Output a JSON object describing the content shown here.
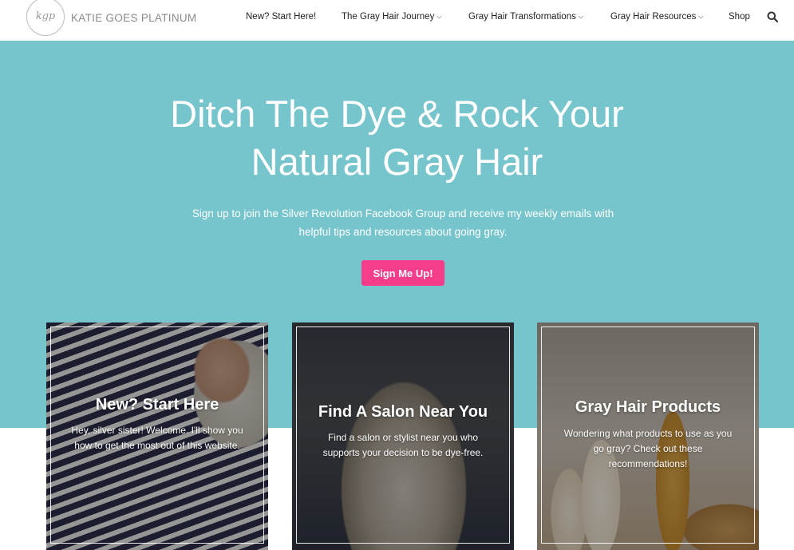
{
  "site": {
    "logo_mark": "kgp",
    "logo_text": "KATIE GOES PLATINUM"
  },
  "nav": {
    "items": [
      {
        "label": "New? Start Here!",
        "has_dropdown": false
      },
      {
        "label": "The Gray Hair Journey",
        "has_dropdown": true
      },
      {
        "label": "Gray Hair Transformations",
        "has_dropdown": true
      },
      {
        "label": "Gray Hair Resources",
        "has_dropdown": true
      },
      {
        "label": "Shop",
        "has_dropdown": false
      }
    ],
    "dropdown_glyph": "⌵",
    "search_icon": "search-icon"
  },
  "hero": {
    "title_line1": "Ditch The Dye & Rock Your",
    "title_line2": "Natural Gray Hair",
    "subtitle": "Sign up to join the Silver Revolution Facebook Group and receive my weekly emails with helpful tips and resources about going gray.",
    "cta_label": "Sign Me Up!"
  },
  "cards": [
    {
      "title": "New? Start Here",
      "text": "Hey, silver sister! Welcome. I'll show you how to get the most out of this website."
    },
    {
      "title": "Find A Salon Near You",
      "text": "Find a salon or stylist near you who supports your decision to be dye-free."
    },
    {
      "title": "Gray Hair Products",
      "text": "Wondering what products to use as you go gray? Check out these recommendations!"
    }
  ],
  "colors": {
    "hero_bg": "#76c5cc",
    "cta_bg": "#f53d8b",
    "text_dark": "#222222"
  }
}
